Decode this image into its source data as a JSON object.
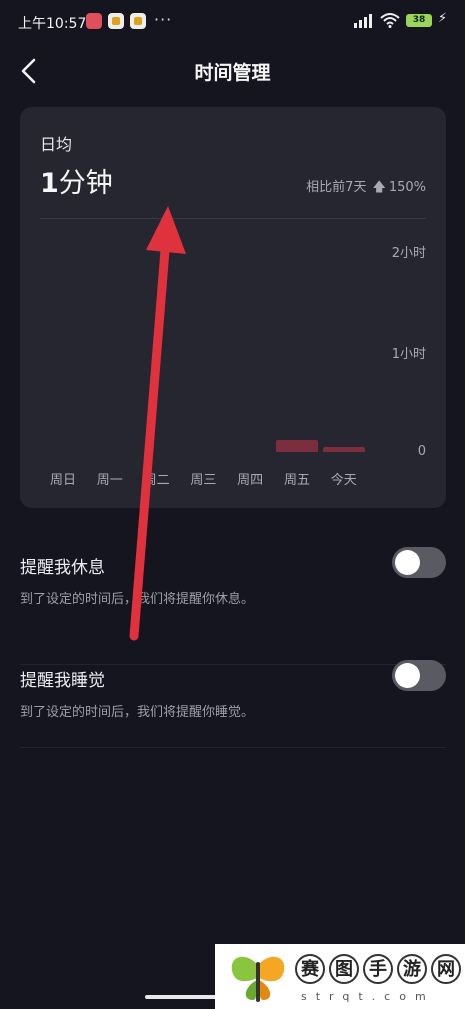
{
  "status_bar": {
    "time": "上午10:57",
    "more": "···",
    "battery": "38"
  },
  "header": {
    "title": "时间管理"
  },
  "stats_card": {
    "avg_label": "日均",
    "avg_number": "1",
    "avg_unit": "分钟",
    "compare_text": "相比前7天",
    "compare_value": "150%",
    "compare_direction": "up"
  },
  "chart_data": {
    "type": "bar",
    "categories": [
      "周日",
      "周一",
      "周二",
      "周三",
      "周四",
      "周五",
      "今天"
    ],
    "values": [
      0,
      0,
      0,
      0,
      0,
      0.12,
      0.05
    ],
    "y_unit": "小时",
    "y_ticks": [
      "2小时",
      "1小时",
      "0"
    ],
    "ylim": [
      0,
      2
    ],
    "bar_color": "#7a2e3e"
  },
  "settings": [
    {
      "title": "提醒我休息",
      "description": "到了设定的时间后，我们将提醒你休息。",
      "enabled": false
    },
    {
      "title": "提醒我睡觉",
      "description": "到了设定的时间后，我们将提醒你睡觉。",
      "enabled": false
    }
  ],
  "watermark": {
    "chars": [
      "赛",
      "图",
      "手",
      "游",
      "网"
    ],
    "url": "strqt.com"
  },
  "colors": {
    "background": "#15151f",
    "card": "#262630",
    "annotation_arrow": "#e0323c"
  }
}
